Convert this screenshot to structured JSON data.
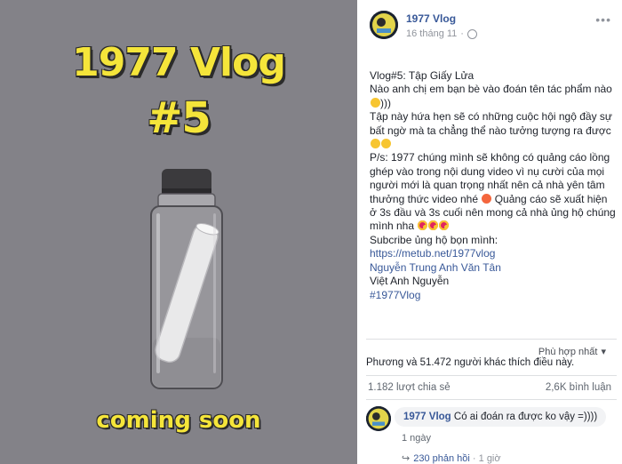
{
  "media": {
    "title_line1": "1977 Vlog",
    "title_line2": "#5",
    "caption": "coming soon",
    "background_color": "#838288",
    "title_color": "#f5e53a"
  },
  "post": {
    "page_name": "1977 Vlog",
    "date": "16 tháng 11",
    "privacy_icon": "globe-icon",
    "more_icon": "more-dots-icon",
    "lines": {
      "l1": "Vlog#5: Tập Giấy Lửa",
      "l2": "Nào anh chị em bạn bè vào đoán tên tác phẩm nào",
      "l3": ")))",
      "l4": "Tập này hứa hẹn sẽ có những cuộc hội ngộ đầy sự bất ngờ mà ta chẳng thể nào tưởng tượng ra được",
      "l5": "P/s: 1977 chúng mình sẽ không có quảng cáo lồng ghép vào trong nội dung video vì nụ cười của mọi người mới là quan trọng nhất nên cả nhà yên tâm thưởng thức video nhé",
      "l6": "Quảng cáo sẽ xuất hiện ở 3s đầu và 3s cuối nên mong cả nhà ủng hộ chúng mình nha",
      "l7": "Subcribe ủng hộ bọn mình:",
      "link_url": "https://metub.net/1977vlog",
      "link_name1": "Nguyễn Trung Anh Văn Tân",
      "plain_name2": "Việt Anh Nguyễn",
      "hashtag": "#1977Vlog"
    },
    "sort_label": "Phù hợp nhất",
    "reactions_text": "Phương và 51.472 người khác thích điều này.",
    "shares_text": "1.182 lượt chia sẻ",
    "comments_text": "2,6K bình luận"
  },
  "comment": {
    "author": "1977 Vlog",
    "text": "Có ai đoán ra được ko vậy =))))",
    "time": "1 ngày",
    "replies_label": "230 phản hồi",
    "replies_time": "1 giờ"
  },
  "colors": {
    "link": "#385898",
    "muted": "#90949c",
    "text": "#1d2129",
    "divider": "#dddfe2"
  }
}
